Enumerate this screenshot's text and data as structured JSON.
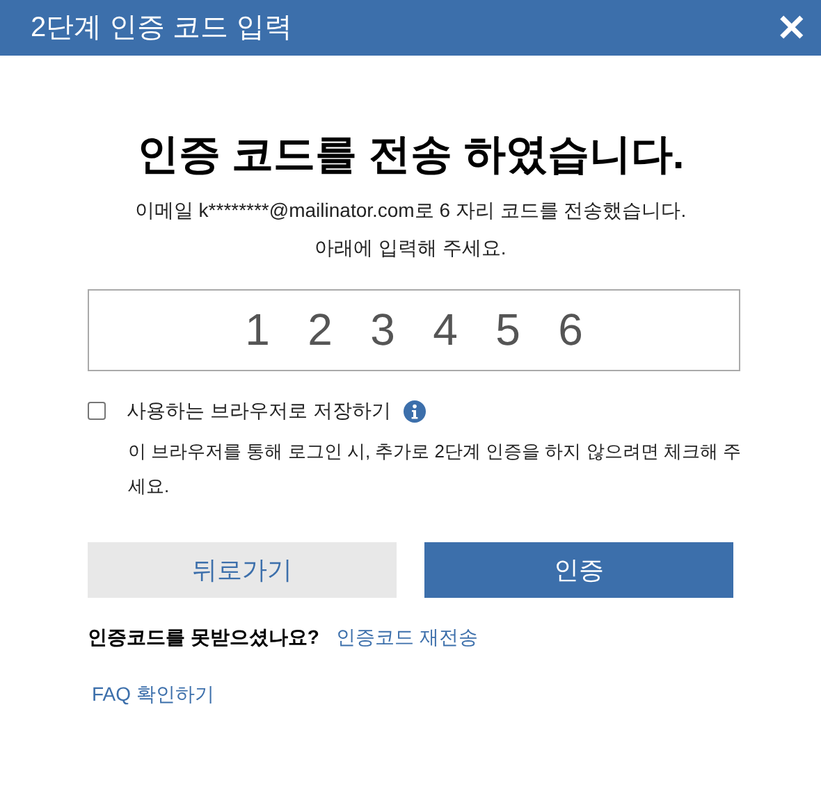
{
  "dialog": {
    "title": "2단계 인증 코드 입력",
    "close_label": "✕"
  },
  "heading": "인증 코드를 전송 하였습니다.",
  "message_lines": [
    "이메일 k********@mailinator.com로 6 자리 코드를 전송했습니다.",
    "아래에 입력해 주세요."
  ],
  "code_field": {
    "value": "123456"
  },
  "remember": {
    "label": "사용하는 브라우저로 저장하기",
    "checked": false,
    "help": "이 브라우저를 통해 로그인 시, 추가로 2단계 인증을 하지 않으려면 체크해 주세요."
  },
  "buttons": [
    {
      "label": "뒤로가기",
      "kind": "secondary"
    },
    {
      "label": "인증",
      "kind": "primary"
    }
  ],
  "resend": {
    "question": "인증코드를 못받으셨나요?",
    "link": "인증코드 재전송"
  },
  "faq_link": "FAQ 확인하기"
}
